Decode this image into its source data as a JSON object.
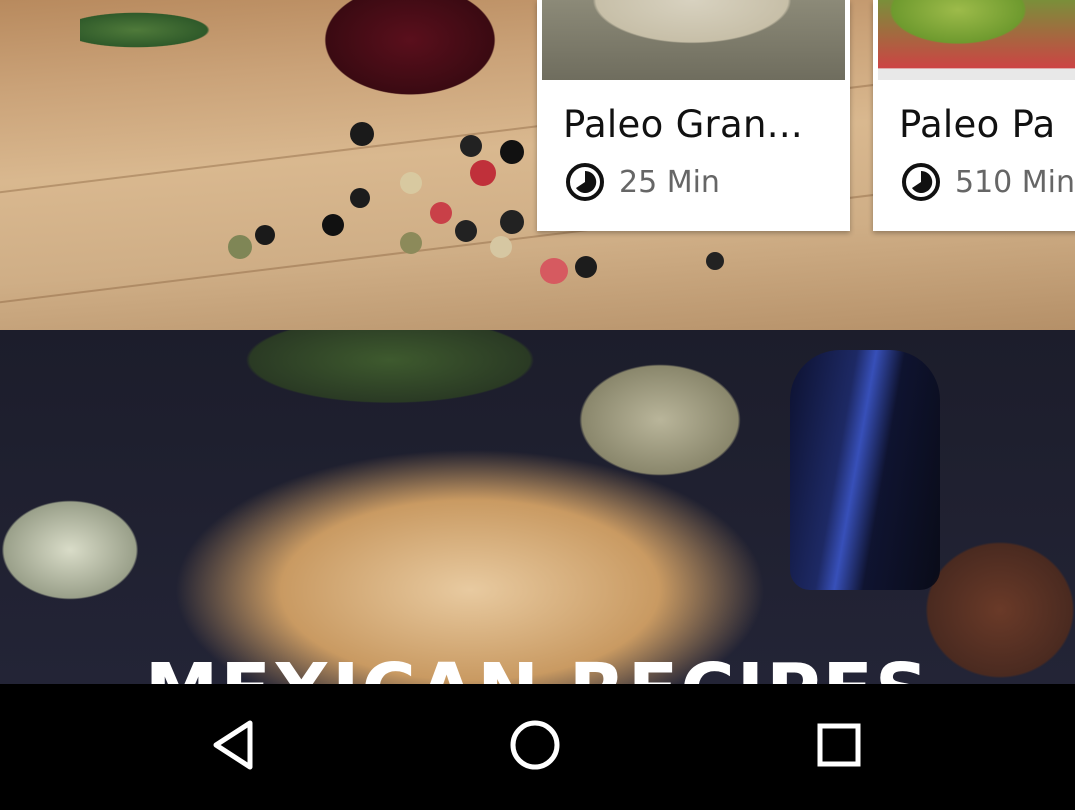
{
  "cards": [
    {
      "title": "Paleo Gran...",
      "duration": "25 Min",
      "icon": "timer-icon"
    },
    {
      "title": "Paleo Pa",
      "duration": "510 Min",
      "icon": "timer-icon"
    }
  ],
  "section": {
    "title": "MEXICAN RECIPES"
  },
  "nav": {
    "back_icon": "back-triangle-icon",
    "home_icon": "home-circle-icon",
    "recent_icon": "recent-square-icon"
  },
  "colors": {
    "card_bg": "#ffffff",
    "title_text": "#111111",
    "meta_text": "#666666",
    "nav_bg": "#000000"
  }
}
